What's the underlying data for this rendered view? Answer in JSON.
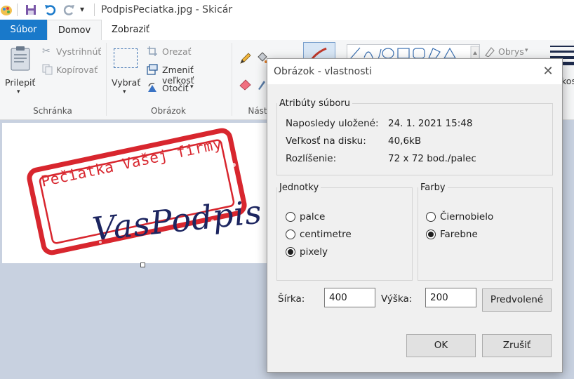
{
  "window": {
    "title": "PodpisPeciatka.jpg - Skicár",
    "qat_overflow": "▾"
  },
  "tabs": {
    "file": "Súbor",
    "home": "Domov",
    "view": "Zobraziť"
  },
  "ribbon": {
    "clipboard": {
      "paste": "Prilepiť",
      "cut": "Vystrihnúť",
      "copy": "Kopírovať",
      "label": "Schránka"
    },
    "image": {
      "select": "Vybrať",
      "crop": "Orezať",
      "resize": "Zmeniť veľkosť",
      "rotate": "Otočiť",
      "label": "Obrázok"
    },
    "tools": {
      "label": "Nást"
    },
    "shapes": {
      "outline": "Obrys"
    },
    "size": {
      "label": "kos"
    }
  },
  "canvas": {
    "stamp_text": "Pečiatka Vašej firmy",
    "signature_text": "VasPodpis"
  },
  "dialog": {
    "title": "Obrázok - vlastnosti",
    "file_attributes": {
      "legend": "Atribúty súboru",
      "rows": [
        {
          "label": "Naposledy uložené:",
          "value": "24. 1. 2021 15:48"
        },
        {
          "label": "Veľkosť na disku:",
          "value": "40,6kB"
        },
        {
          "label": "Rozlíšenie:",
          "value": "72 x 72 bod./palec"
        }
      ]
    },
    "units": {
      "legend": "Jednotky",
      "options": [
        {
          "label": "palce",
          "checked": false
        },
        {
          "label": "centimetre",
          "checked": false
        },
        {
          "label": "pixely",
          "checked": true
        }
      ]
    },
    "colors": {
      "legend": "Farby",
      "options": [
        {
          "label": "Čiernobielo",
          "checked": false
        },
        {
          "label": "Farebne",
          "checked": true
        }
      ]
    },
    "width_label": "Šírka:",
    "width_value": "400",
    "height_label": "Výška:",
    "height_value": "200",
    "default_button": "Predvolené",
    "ok_button": "OK",
    "cancel_button": "Zrušiť"
  },
  "colors": {
    "accent": "#1979ca",
    "stamp_red": "#d8262e",
    "signature_navy": "#1c2560"
  }
}
